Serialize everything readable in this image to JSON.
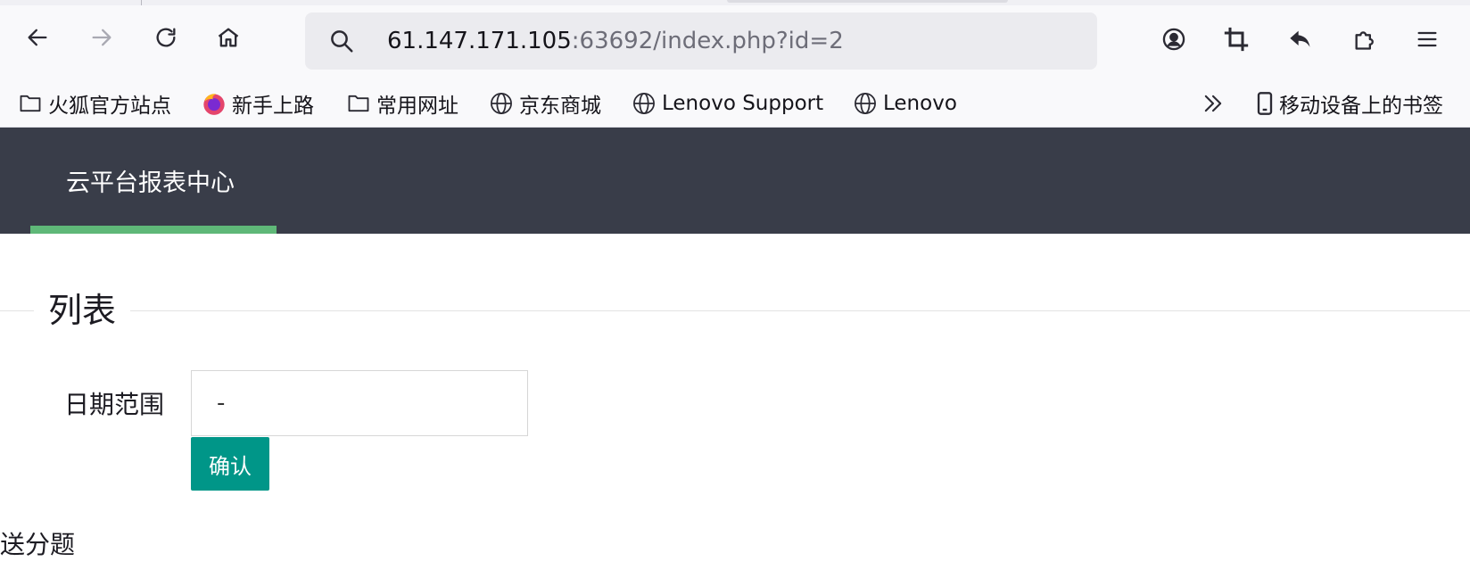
{
  "browser": {
    "url_host": "61.147.171.105",
    "url_rest": ":63692/index.php?id=2",
    "bookmarks": [
      {
        "label": "火狐官方站点",
        "icon": "folder-icon"
      },
      {
        "label": "新手上路",
        "icon": "firefox-icon"
      },
      {
        "label": "常用网址",
        "icon": "folder-icon"
      },
      {
        "label": "京东商城",
        "icon": "globe-icon"
      },
      {
        "label": "Lenovo Support",
        "icon": "globe-icon"
      },
      {
        "label": "Lenovo",
        "icon": "globe-icon"
      }
    ],
    "mobile_bookmarks_label": "移动设备上的书签",
    "icons": {
      "back": "back-arrow-icon",
      "forward": "forward-arrow-icon",
      "reload": "reload-icon",
      "home": "home-icon",
      "account": "account-icon",
      "screenshot": "crop-icon",
      "undo": "undo-icon",
      "extensions": "puzzle-icon",
      "menu": "hamburger-menu-icon",
      "overflow": "double-chevron-icon"
    }
  },
  "page": {
    "nav_title": "云平台报表中心",
    "section_title": "列表",
    "date_range_label": "日期范围",
    "date_input_value": "-",
    "confirm_label": "确认",
    "footer_text": "送分题"
  },
  "colors": {
    "nav_bg": "#393d49",
    "nav_active_bar": "#5fb878",
    "confirm_button": "#009688"
  }
}
